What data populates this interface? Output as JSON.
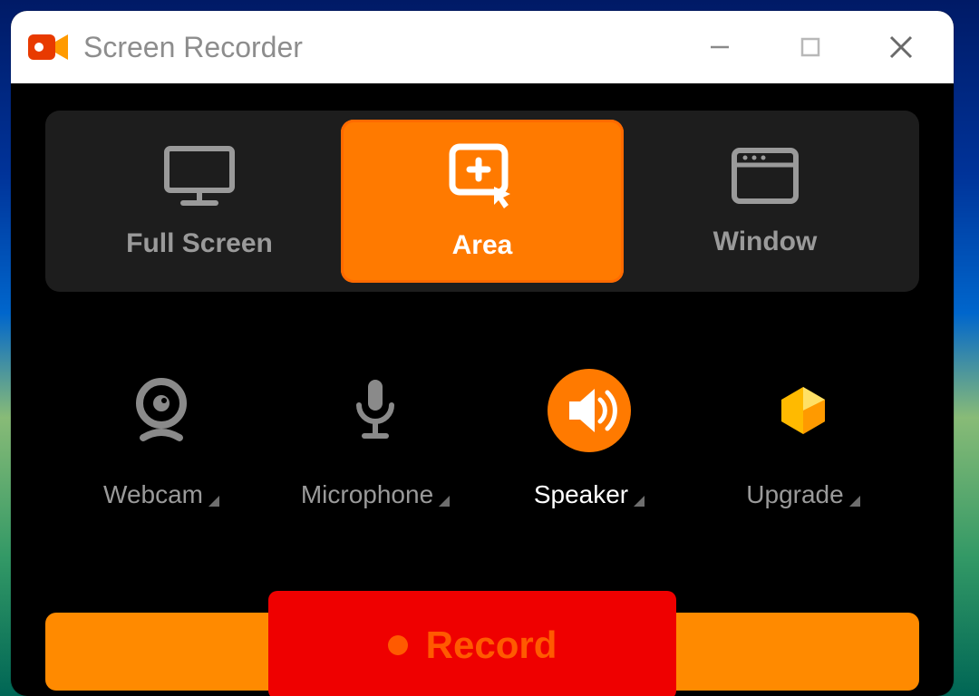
{
  "titlebar": {
    "title": "Screen Recorder"
  },
  "modes": {
    "fullscreen": {
      "label": "Full Screen"
    },
    "area": {
      "label": "Area"
    },
    "window": {
      "label": "Window"
    },
    "selected": "area"
  },
  "options": {
    "webcam": {
      "label": "Webcam",
      "active": false
    },
    "microphone": {
      "label": "Microphone",
      "active": false
    },
    "speaker": {
      "label": "Speaker",
      "active": true
    },
    "upgrade": {
      "label": "Upgrade",
      "active": false
    }
  },
  "record": {
    "label": "Record"
  },
  "colors": {
    "accent": "#ff7a00",
    "record": "#ef0000"
  }
}
